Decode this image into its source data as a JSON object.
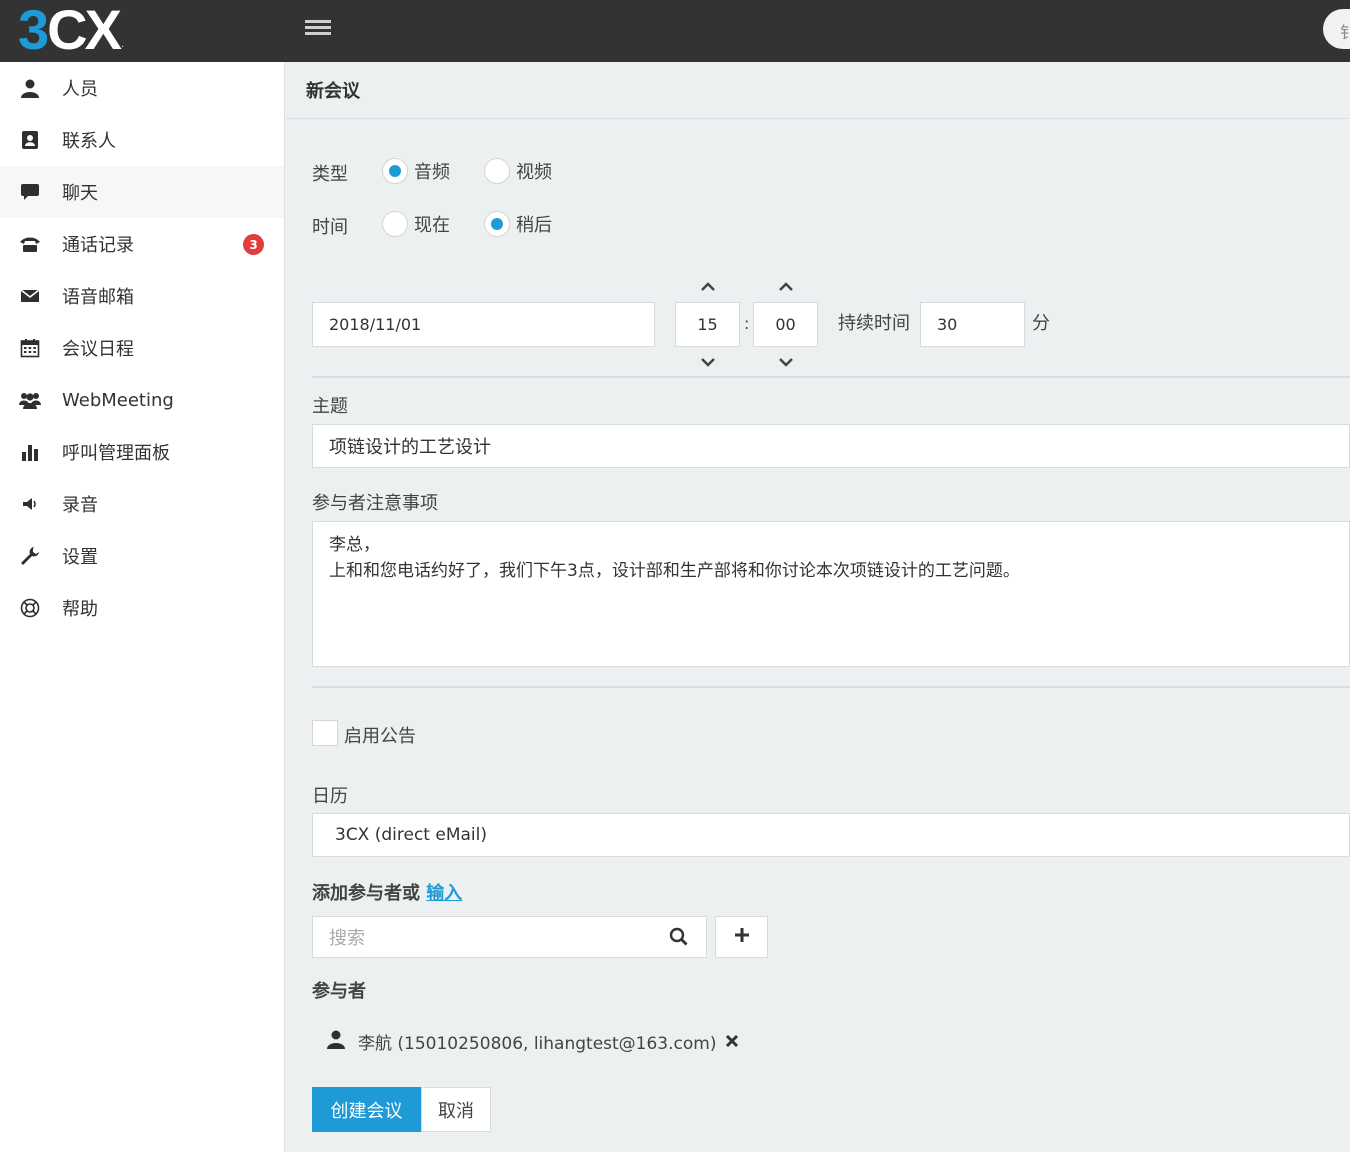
{
  "header": {
    "logo_main": "3",
    "logo_rest": "CX",
    "logo_mark": ".",
    "top_right_text": "钅"
  },
  "sidebar": {
    "items": [
      {
        "label": "人员",
        "icon": "user-icon"
      },
      {
        "label": "联系人",
        "icon": "address-book-icon"
      },
      {
        "label": "聊天",
        "icon": "chat-icon"
      },
      {
        "label": "通话记录",
        "icon": "phone-icon",
        "badge": "3"
      },
      {
        "label": "语音邮箱",
        "icon": "envelope-icon"
      },
      {
        "label": "会议日程",
        "icon": "calendar-icon"
      },
      {
        "label": "WebMeeting",
        "icon": "users-icon"
      },
      {
        "label": "呼叫管理面板",
        "icon": "bar-chart-icon"
      },
      {
        "label": "录音",
        "icon": "speaker-icon"
      },
      {
        "label": "设置",
        "icon": "wrench-icon"
      },
      {
        "label": "帮助",
        "icon": "lifebuoy-icon"
      }
    ]
  },
  "main": {
    "title": "新会议",
    "type_label": "类型",
    "type_options": [
      "音频",
      "视频"
    ],
    "type_selected": "音频",
    "time_label": "时间",
    "time_options": [
      "现在",
      "稍后"
    ],
    "time_selected": "稍后",
    "date_value": "2018/11/01",
    "hour_value": "15",
    "time_separator": ":",
    "minute_value": "00",
    "duration_label": "持续时间",
    "duration_value": "30",
    "duration_unit": "分",
    "subject_label": "主题",
    "subject_value": "项链设计的工艺设计",
    "notes_label": "参与者注意事项",
    "notes_value": "李总，\n上和和您电话约好了，我们下午3点，设计部和生产部将和你讨论本次项链设计的工艺问题。",
    "announce_label": "启用公告",
    "calendar_label": "日历",
    "calendar_value": "3CX (direct eMail)",
    "add_participants_label": "添加参与者或",
    "add_participants_link": "输入",
    "search_placeholder": "搜索",
    "participants_label": "参与者",
    "participants": [
      {
        "text": "李航 (15010250806, lihangtest@163.com)"
      }
    ],
    "create_button": "创建会议",
    "cancel_button": "取消"
  },
  "colors": {
    "accent": "#1e9bd7",
    "topbar": "#333333",
    "badge": "#e23c3c",
    "content_bg": "#ecf0f1"
  }
}
